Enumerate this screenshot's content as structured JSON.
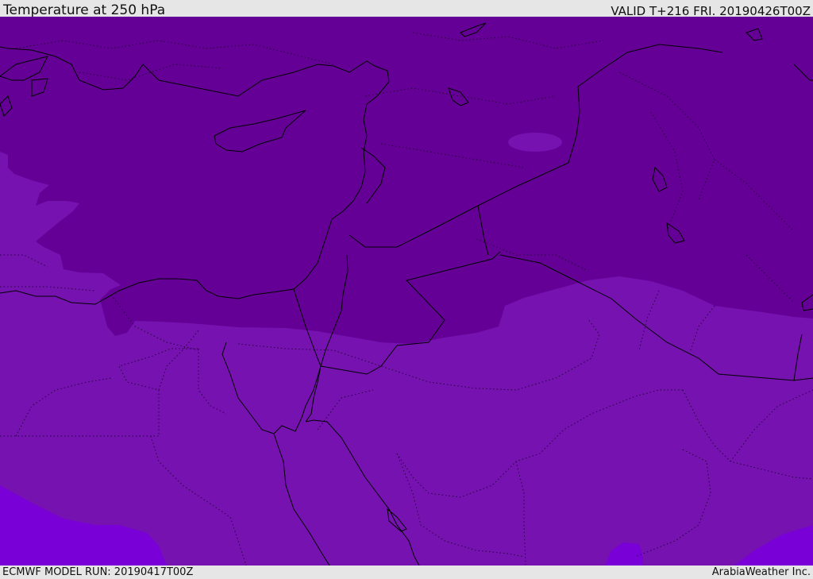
{
  "header": {
    "title": "Temperature at 250 hPa",
    "valid": "VALID T+216 FRI. 20190426T00Z"
  },
  "footer": {
    "model_run": "ECMWF MODEL RUN: 20190417T00Z",
    "credit": "ArabiaWeather Inc."
  },
  "colors": {
    "cold_band": "#650096",
    "mid_band": "#7512b0",
    "warm_band": "#7a00d8",
    "coastline": "#000000",
    "border": "#000000"
  }
}
